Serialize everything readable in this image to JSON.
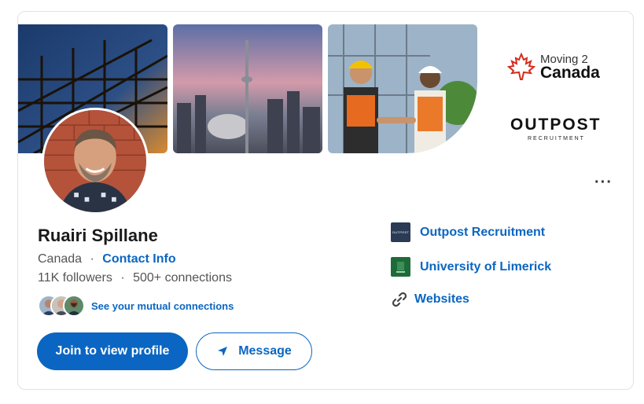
{
  "brands": {
    "m2c_line1": "Moving 2",
    "m2c_line2": "Canada",
    "outpost_main": "OUTPOST",
    "outpost_sub": "RECRUITMENT"
  },
  "profile": {
    "name": "Ruairi Spillane",
    "location": "Canada",
    "separator": "·",
    "contact_info": "Contact Info",
    "followers": "11K followers",
    "connections": "500+ connections",
    "mutual_link": "See your mutual connections"
  },
  "actions": {
    "more": "···",
    "join": "Join to view profile",
    "message": "Message"
  },
  "right": {
    "company": "Outpost Recruitment",
    "company_logo_text": "OUTPOST",
    "school": "University of Limerick",
    "websites": "Websites"
  },
  "colors": {
    "accent": "#0a66c2",
    "avatar_ring": "#3b5fa6"
  },
  "icons": {
    "more": "more-options-icon",
    "send": "send-icon",
    "link": "link-icon",
    "maple": "maple-leaf-icon"
  }
}
